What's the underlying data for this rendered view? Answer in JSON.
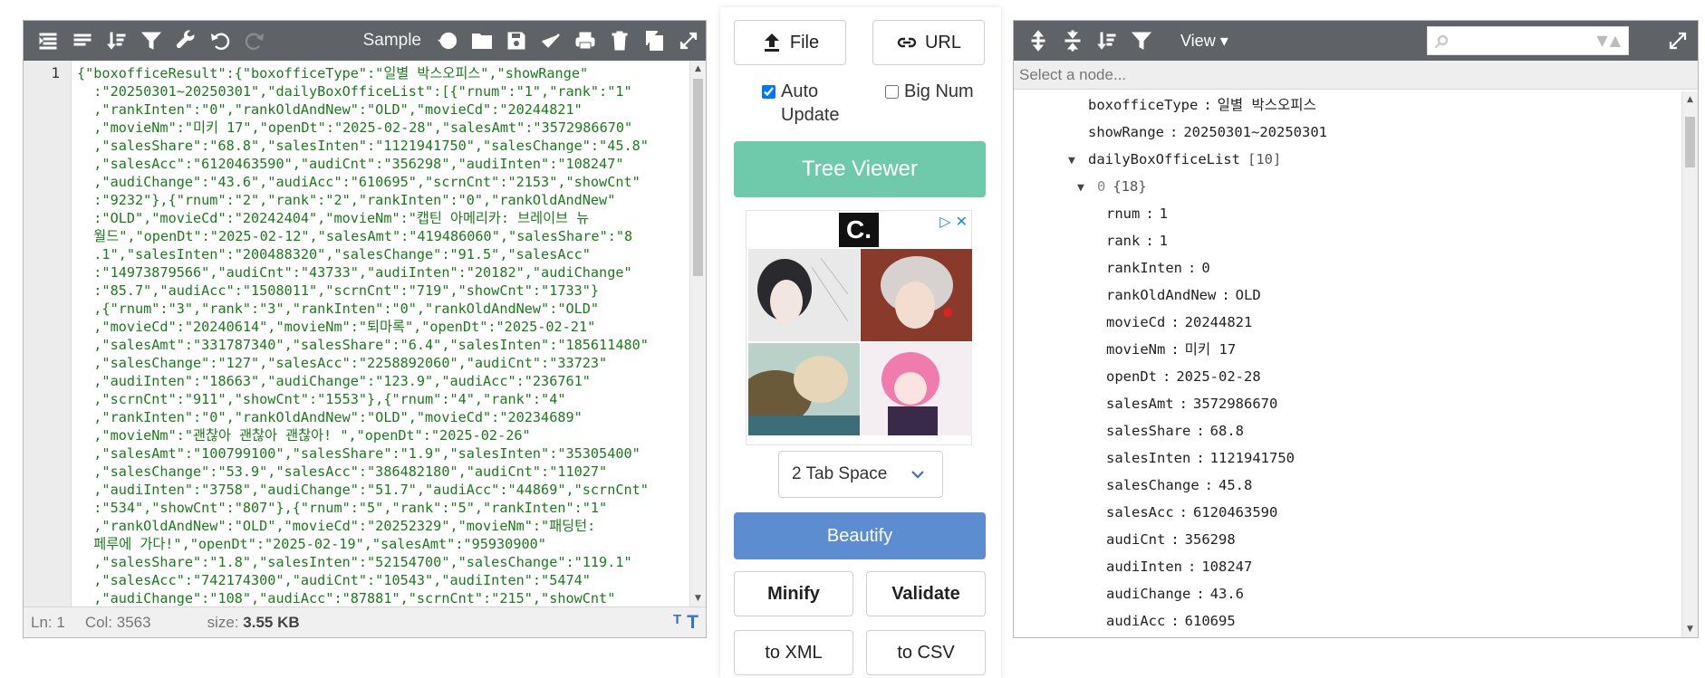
{
  "left_toolbar": {
    "sample_label": "Sample",
    "icons_left": [
      "format-icon",
      "compact-icon",
      "sort-icon",
      "filter-icon",
      "repair-icon",
      "undo-icon",
      "redo-icon"
    ],
    "icons_right": [
      "history-icon",
      "open-icon",
      "save-icon",
      "validate-icon",
      "print-icon",
      "delete-icon",
      "copy-icon",
      "fullscreen-icon"
    ]
  },
  "editor": {
    "line_number": "1",
    "lines": [
      "{\"boxofficeResult\":{\"boxofficeType\":\"일별 박스오피스\",\"showRange\"",
      "  :\"20250301~20250301\",\"dailyBoxOfficeList\":[{\"rnum\":\"1\",\"rank\":\"1\"",
      "  ,\"rankInten\":\"0\",\"rankOldAndNew\":\"OLD\",\"movieCd\":\"20244821\"",
      "  ,\"movieNm\":\"미키 17\",\"openDt\":\"2025-02-28\",\"salesAmt\":\"3572986670\"",
      "  ,\"salesShare\":\"68.8\",\"salesInten\":\"1121941750\",\"salesChange\":\"45.8\"",
      "  ,\"salesAcc\":\"6120463590\",\"audiCnt\":\"356298\",\"audiInten\":\"108247\"",
      "  ,\"audiChange\":\"43.6\",\"audiAcc\":\"610695\",\"scrnCnt\":\"2153\",\"showCnt\"",
      "  :\"9232\"},{\"rnum\":\"2\",\"rank\":\"2\",\"rankInten\":\"0\",\"rankOldAndNew\"",
      "  :\"OLD\",\"movieCd\":\"20242404\",\"movieNm\":\"캡틴 아메리카: 브레이브 뉴",
      "  월드\",\"openDt\":\"2025-02-12\",\"salesAmt\":\"419486060\",\"salesShare\":\"8",
      "  .1\",\"salesInten\":\"200488320\",\"salesChange\":\"91.5\",\"salesAcc\"",
      "  :\"14973879566\",\"audiCnt\":\"43733\",\"audiInten\":\"20182\",\"audiChange\"",
      "  :\"85.7\",\"audiAcc\":\"1508011\",\"scrnCnt\":\"719\",\"showCnt\":\"1733\"}",
      "  ,{\"rnum\":\"3\",\"rank\":\"3\",\"rankInten\":\"0\",\"rankOldAndNew\":\"OLD\"",
      "  ,\"movieCd\":\"20240614\",\"movieNm\":\"퇴마록\",\"openDt\":\"2025-02-21\"",
      "  ,\"salesAmt\":\"331787340\",\"salesShare\":\"6.4\",\"salesInten\":\"185611480\"",
      "  ,\"salesChange\":\"127\",\"salesAcc\":\"2258892060\",\"audiCnt\":\"33723\"",
      "  ,\"audiInten\":\"18663\",\"audiChange\":\"123.9\",\"audiAcc\":\"236761\"",
      "  ,\"scrnCnt\":\"911\",\"showCnt\":\"1553\"},{\"rnum\":\"4\",\"rank\":\"4\"",
      "  ,\"rankInten\":\"0\",\"rankOldAndNew\":\"OLD\",\"movieCd\":\"20234689\"",
      "  ,\"movieNm\":\"괜찮아 괜찮아 괜찮아! \",\"openDt\":\"2025-02-26\"",
      "  ,\"salesAmt\":\"100799100\",\"salesShare\":\"1.9\",\"salesInten\":\"35305400\"",
      "  ,\"salesChange\":\"53.9\",\"salesAcc\":\"386482180\",\"audiCnt\":\"11027\"",
      "  ,\"audiInten\":\"3758\",\"audiChange\":\"51.7\",\"audiAcc\":\"44869\",\"scrnCnt\"",
      "  :\"534\",\"showCnt\":\"807\"},{\"rnum\":\"5\",\"rank\":\"5\",\"rankInten\":\"1\"",
      "  ,\"rankOldAndNew\":\"OLD\",\"movieCd\":\"20252329\",\"movieNm\":\"패딩턴:",
      "  페루에 가다!\",\"openDt\":\"2025-02-19\",\"salesAmt\":\"95930900\"",
      "  ,\"salesShare\":\"1.8\",\"salesInten\":\"52154700\",\"salesChange\":\"119.1\"",
      "  ,\"salesAcc\":\"742174300\",\"audiCnt\":\"10543\",\"audiInten\":\"5474\"",
      "  ,\"audiChange\":\"108\",\"audiAcc\":\"87881\",\"scrnCnt\":\"215\",\"showCnt\""
    ]
  },
  "status": {
    "ln": "Ln: 1",
    "col": "Col: 3563",
    "size_label": "size: ",
    "size_value": "3.55 KB"
  },
  "middle": {
    "file_label": "File",
    "url_label": "URL",
    "auto_update_label": "Auto Update",
    "auto_update_checked": true,
    "big_num_label": "Big Num",
    "big_num_checked": false,
    "tree_viewer_label": "Tree Viewer",
    "indent_select": "2 Tab Space",
    "beautify_label": "Beautify",
    "minify_label": "Minify",
    "validate_label": "Validate",
    "to_xml_label": "to XML",
    "to_csv_label": "to CSV",
    "ad_logo": "C.",
    "colors": {
      "tree_viewer": "#6ecaaa",
      "beautify": "#5b8dd0",
      "toolbar": "#5f6368"
    }
  },
  "right_toolbar": {
    "view_label": "View ▾",
    "icons": [
      "expand-all-icon",
      "collapse-all-icon",
      "sort-icon",
      "filter-icon"
    ],
    "search_placeholder": ""
  },
  "tree": {
    "select_placeholder": "Select a node...",
    "rows": [
      {
        "indent": 1,
        "key": "boxofficeType",
        "value": "일별 박스오피스"
      },
      {
        "indent": 1,
        "key": "showRange",
        "value": "20250301~20250301"
      },
      {
        "indent": 1,
        "key": "dailyBoxOfficeList",
        "count": "[10]",
        "expanded": true
      },
      {
        "indent": 2,
        "key": "0",
        "count": "{18}",
        "expanded": true
      },
      {
        "indent": 3,
        "key": "rnum",
        "value": "1"
      },
      {
        "indent": 3,
        "key": "rank",
        "value": "1"
      },
      {
        "indent": 3,
        "key": "rankInten",
        "value": "0"
      },
      {
        "indent": 3,
        "key": "rankOldAndNew",
        "value": "OLD"
      },
      {
        "indent": 3,
        "key": "movieCd",
        "value": "20244821"
      },
      {
        "indent": 3,
        "key": "movieNm",
        "value": "미키 17"
      },
      {
        "indent": 3,
        "key": "openDt",
        "value": "2025-02-28"
      },
      {
        "indent": 3,
        "key": "salesAmt",
        "value": "3572986670"
      },
      {
        "indent": 3,
        "key": "salesShare",
        "value": "68.8"
      },
      {
        "indent": 3,
        "key": "salesInten",
        "value": "1121941750"
      },
      {
        "indent": 3,
        "key": "salesChange",
        "value": "45.8"
      },
      {
        "indent": 3,
        "key": "salesAcc",
        "value": "6120463590"
      },
      {
        "indent": 3,
        "key": "audiCnt",
        "value": "356298"
      },
      {
        "indent": 3,
        "key": "audiInten",
        "value": "108247"
      },
      {
        "indent": 3,
        "key": "audiChange",
        "value": "43.6"
      },
      {
        "indent": 3,
        "key": "audiAcc",
        "value": "610695"
      }
    ]
  }
}
